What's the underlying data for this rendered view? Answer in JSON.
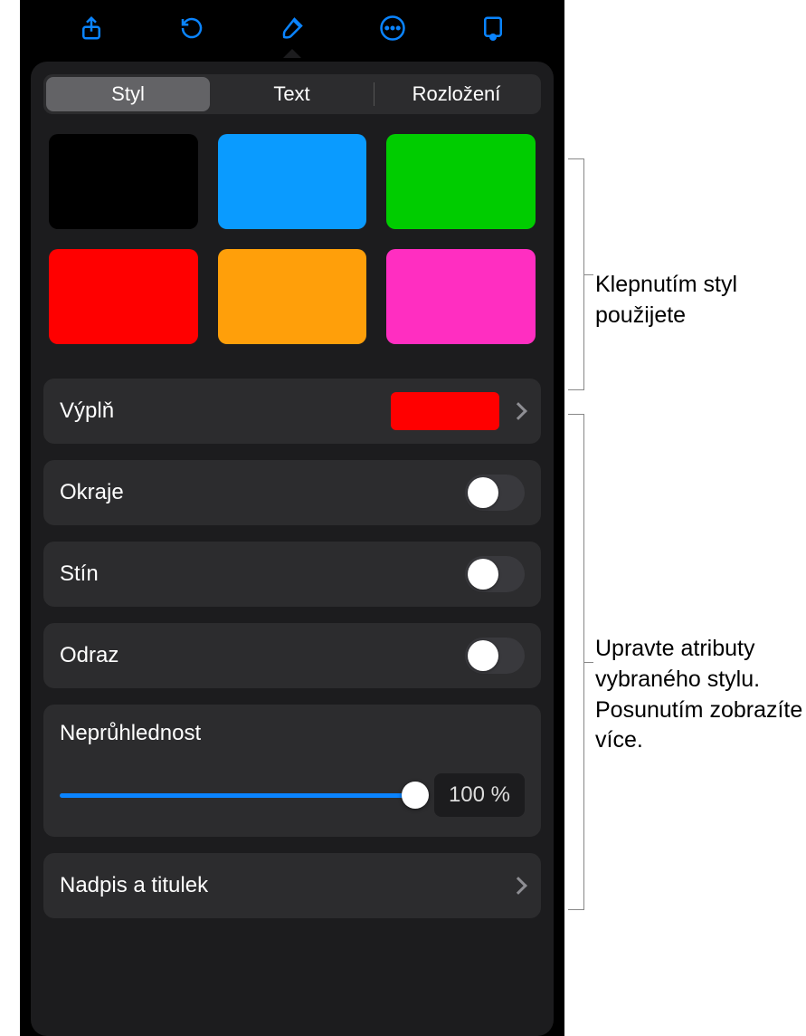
{
  "toolbar": {
    "icons": [
      "share-icon",
      "undo-icon",
      "brush-icon",
      "more-icon",
      "document-icon"
    ]
  },
  "tabs": {
    "items": [
      {
        "label": "Styl",
        "active": true
      },
      {
        "label": "Text",
        "active": false
      },
      {
        "label": "Rozložení",
        "active": false
      }
    ]
  },
  "swatches": [
    "#000000",
    "#0a9bff",
    "#00cc00",
    "#ff0000",
    "#ff9f0a",
    "#ff2ec1"
  ],
  "fill": {
    "label": "Výplň",
    "color": "#ff0000"
  },
  "toggles": [
    {
      "label": "Okraje",
      "on": false
    },
    {
      "label": "Stín",
      "on": false
    },
    {
      "label": "Odraz",
      "on": false
    }
  ],
  "opacity": {
    "label": "Neprůhlednost",
    "value_text": "100 %",
    "percent": 100
  },
  "caption_row": {
    "label": "Nadpis a titulek"
  },
  "callouts": {
    "swatch_hint": "Klepnutím styl použijete",
    "attrs_hint": "Upravte atributy vybraného stylu. Posunutím zobrazíte více."
  }
}
